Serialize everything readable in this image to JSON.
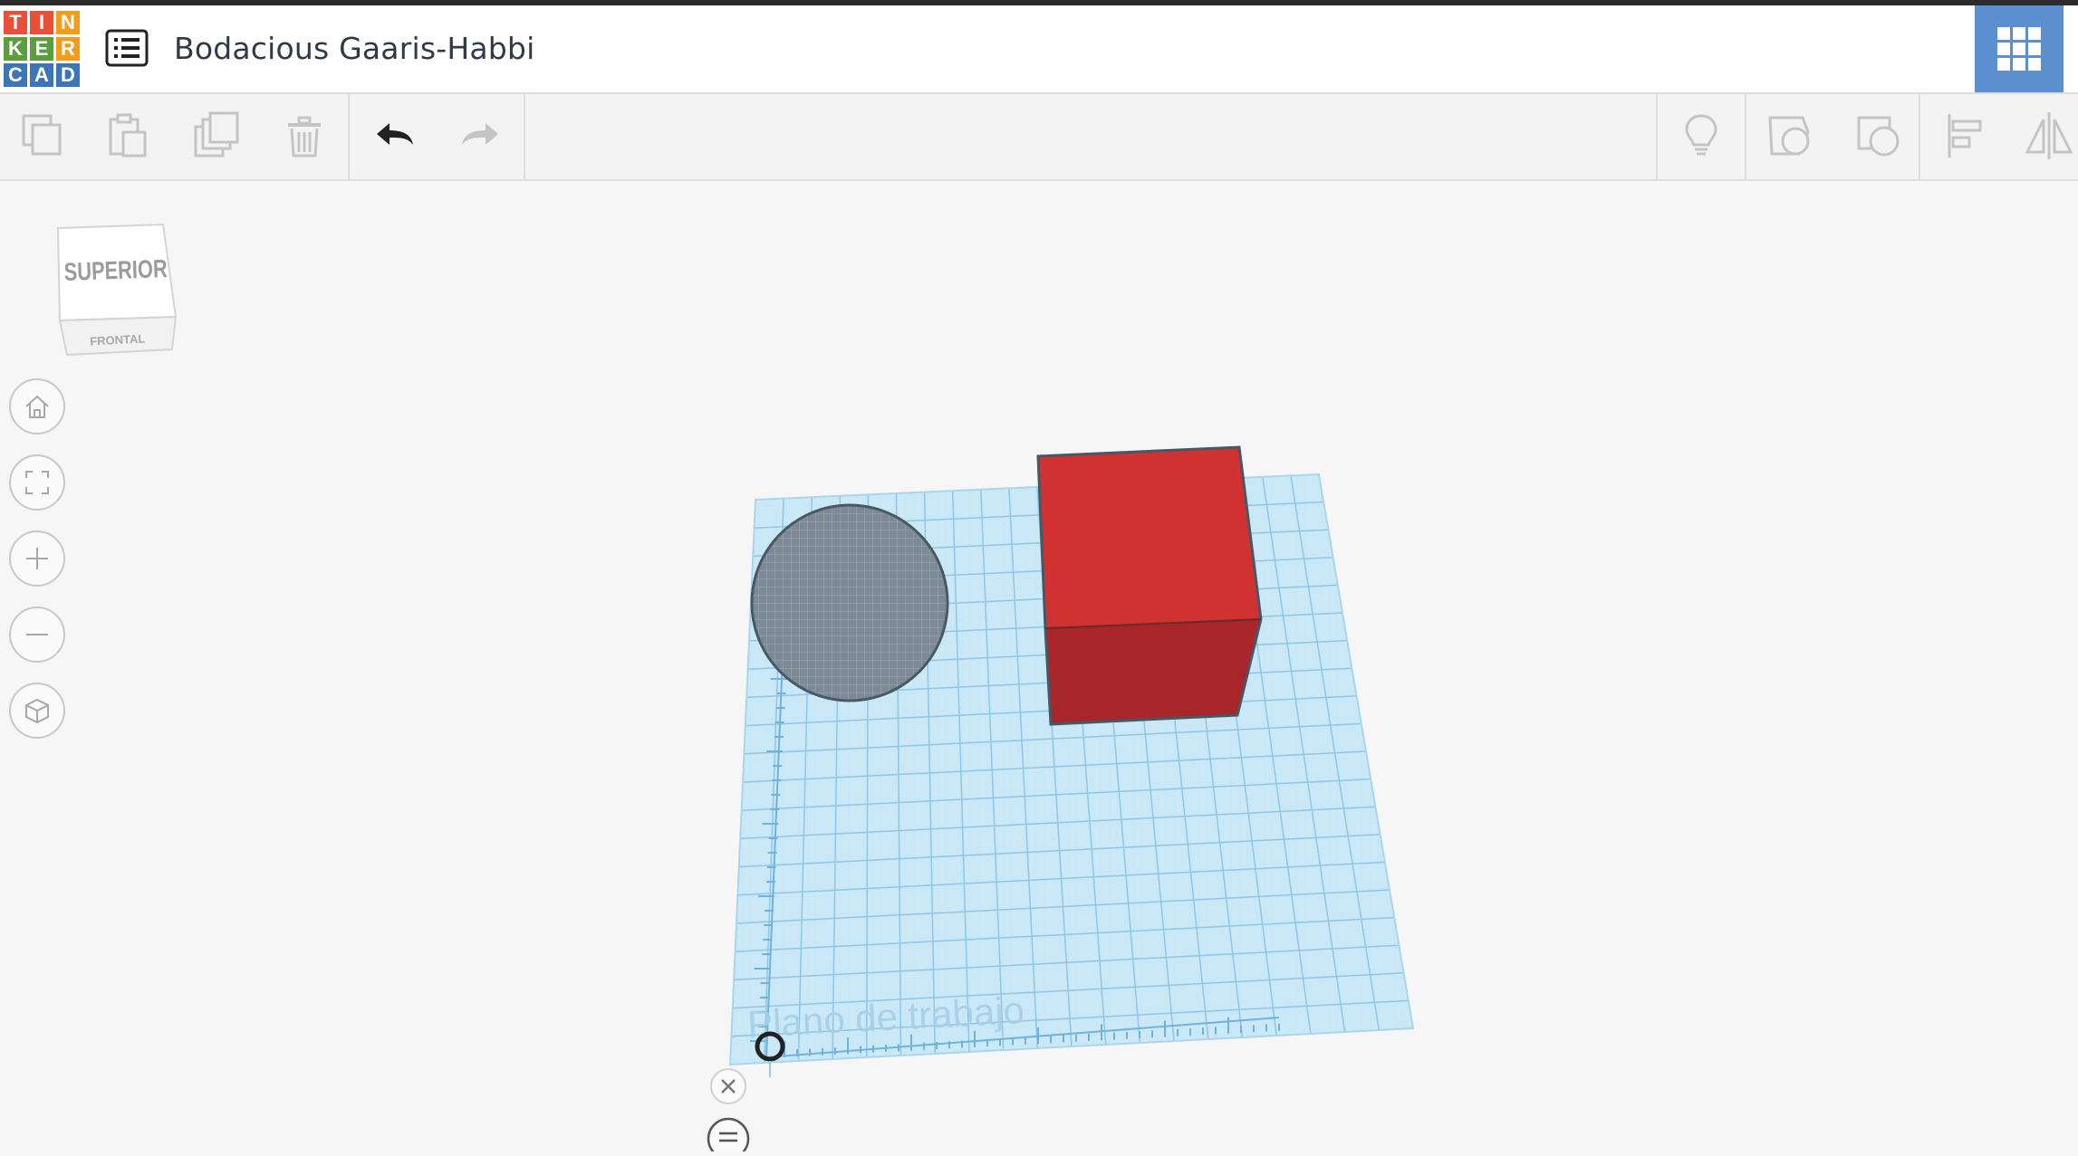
{
  "header": {
    "logo_letters": [
      "T",
      "I",
      "N",
      "K",
      "E",
      "R",
      "C",
      "A",
      "D"
    ],
    "logo_colors": [
      "#e8503a",
      "#e8503a",
      "#f39c1c",
      "#5b9e3c",
      "#5b9e3c",
      "#f39c1c",
      "#3c76b9",
      "#3c76b9",
      "#3c76b9"
    ],
    "project_title": "Bodacious Gaaris-Habbi"
  },
  "toolbar": {
    "icons": [
      "copy-icon",
      "paste-icon",
      "duplicate-icon",
      "delete-icon",
      "undo-icon",
      "redo-icon",
      "lightbulb-icon",
      "shape-hole-icon",
      "shape-solid-icon",
      "align-icon",
      "mirror-icon"
    ]
  },
  "viewcube": {
    "top_label": "SUPERIOR",
    "front_label": "FRONTAL"
  },
  "nav_controls": [
    "home-icon",
    "fit-view-icon",
    "zoom-in-icon",
    "zoom-out-icon",
    "perspective-icon"
  ],
  "workplane": {
    "label": "Plano de trabajo",
    "grid_color": "#a9d6ee"
  },
  "shapes": [
    {
      "type": "sphere",
      "color": "#7d8a96"
    },
    {
      "type": "box",
      "color": "#d03232"
    }
  ],
  "colors": {
    "accent": "#5b8fd0",
    "box_red": "#d03232"
  }
}
